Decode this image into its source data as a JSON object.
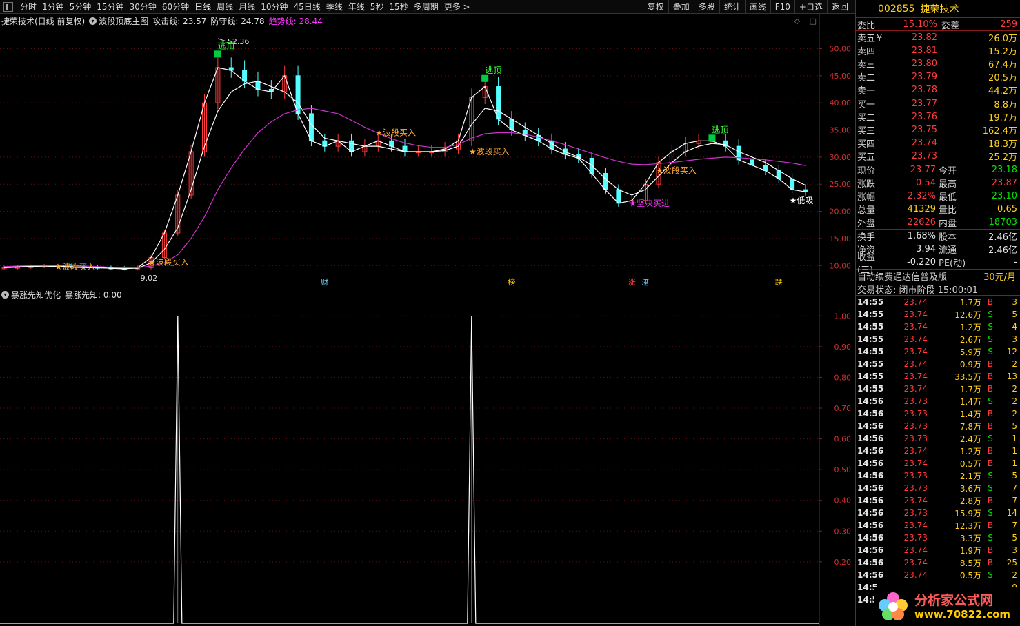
{
  "toolbar": {
    "periods": [
      "分时",
      "1分钟",
      "5分钟",
      "15分钟",
      "30分钟",
      "60分钟",
      "日线",
      "周线",
      "月线",
      "10分钟",
      "45日线",
      "季线",
      "年线",
      "5秒",
      "15秒",
      "多周期",
      "更多 >"
    ],
    "actions": [
      "复权",
      "叠加",
      "多股",
      "统计",
      "画线",
      "F10",
      "+自选",
      "返回"
    ]
  },
  "main_header": {
    "title": "捷荣技术(日线 前复权)",
    "indicator": "波段顶底主图",
    "attack": "攻击线: 23.57",
    "defense": "防守线: 24.78",
    "trend": "趋势线: 28.44"
  },
  "ind_header": {
    "name": "暴涨先知优化",
    "value": "暴涨先知: 0.00"
  },
  "chart_data": [
    {
      "type": "line",
      "title": "捷荣技术(日线 前复权)",
      "xlabel": "",
      "ylabel": "",
      "ylim": [
        8,
        54
      ],
      "yticks": [
        "50.00",
        "45.00",
        "40.00",
        "35.00",
        "30.00",
        "25.00",
        "20.00",
        "15.00",
        "10.00"
      ],
      "max_label": "52.36",
      "min_label": "9.02",
      "series": [
        {
          "name": "攻击线",
          "color": "#ffffff",
          "values": [
            9.6,
            9.7,
            9.8,
            9.9,
            9.9,
            9.8,
            9.7,
            9.6,
            9.5,
            9.4,
            9.6,
            11.5,
            16,
            23,
            31,
            40,
            46.5,
            46,
            44,
            42.5,
            42,
            45,
            38,
            33,
            32,
            33,
            31,
            32,
            33,
            32,
            31,
            31,
            31,
            31.5,
            33,
            41,
            43,
            37,
            35,
            34,
            33,
            31.5,
            30.5,
            29.8,
            27,
            24,
            21.5,
            22,
            25,
            29,
            31,
            32.5,
            33,
            33,
            32,
            29.5,
            28.5,
            27.5,
            26,
            24,
            23.6
          ]
        },
        {
          "name": "防守线",
          "color": "#ffffff",
          "values": [
            9.7,
            9.8,
            9.9,
            9.9,
            9.8,
            9.7,
            9.6,
            9.6,
            9.5,
            9.5,
            9.5,
            10.5,
            13,
            17,
            24,
            32,
            38.5,
            42,
            43.5,
            44,
            43,
            42,
            40,
            36,
            33.5,
            33,
            32.5,
            32,
            32,
            31.5,
            31,
            31,
            31,
            31.2,
            32,
            36,
            39,
            38.5,
            37,
            35.5,
            34,
            32.5,
            31,
            30,
            28.5,
            26,
            24,
            23,
            24,
            26.5,
            29,
            31,
            32,
            32.5,
            32.3,
            31,
            30,
            29,
            27.5,
            26,
            24.8
          ]
        },
        {
          "name": "趋势线",
          "color": "#cc33cc",
          "values": [
            9.8,
            9.9,
            10,
            10,
            10,
            10,
            9.9,
            9.8,
            9.7,
            9.6,
            9.6,
            9.9,
            10.5,
            12,
            15,
            19,
            24,
            28,
            31.5,
            34.5,
            36.5,
            38,
            38.7,
            39,
            38.5,
            38,
            36.8,
            35.5,
            34.4,
            33.4,
            32.6,
            32.1,
            31.8,
            31.8,
            32.3,
            33.5,
            34.3,
            34.5,
            34.5,
            34.2,
            33.7,
            33,
            32.3,
            31.5,
            30.7,
            29.9,
            29.2,
            28.7,
            28.6,
            28.8,
            29,
            29.3,
            29.6,
            29.8,
            30,
            29.9,
            29.7,
            29.5,
            29.2,
            28.9,
            28.44
          ]
        }
      ],
      "annotations": [
        {
          "label": "逃顶",
          "x": 16,
          "value": 49
        },
        {
          "label": "逃顶",
          "x": 36,
          "value": 44.5
        },
        {
          "label": "逃顶",
          "x": 53,
          "value": 33.5
        },
        {
          "label": "波段买入",
          "x": 4,
          "value": 9.8
        },
        {
          "label": "波段买入",
          "x": 11,
          "value": 10.6
        },
        {
          "label": "波段买入",
          "x": 28,
          "value": 34.5
        },
        {
          "label": "波段买入",
          "x": 35,
          "value": 31
        },
        {
          "label": "波段买入",
          "x": 49,
          "value": 27.5
        },
        {
          "label": "坚决买进",
          "x": 47,
          "value": 21.5
        },
        {
          "label": "低吸",
          "x": 59,
          "value": 22
        }
      ],
      "events": [
        {
          "label": "财",
          "x": 24,
          "color": "#66ccff"
        },
        {
          "label": "榜",
          "x": 38,
          "color": "#ffcc00"
        },
        {
          "label": "涨",
          "x": 47,
          "color": "#ff4444"
        },
        {
          "label": "港",
          "x": 48,
          "color": "#66ccff"
        },
        {
          "label": "跌",
          "x": 58,
          "color": "#ffcc00"
        }
      ],
      "grid": true
    },
    {
      "type": "line",
      "title": "暴涨先知优化",
      "xlabel": "",
      "ylabel": "",
      "ylim": [
        0,
        1.05
      ],
      "yticks": [
        "1.00",
        "0.90",
        "0.80",
        "0.70",
        "0.60",
        "0.50",
        "0.40",
        "0.30",
        "0.20"
      ],
      "series": [
        {
          "name": "暴涨先知",
          "color": "#ffffff",
          "spikes": [
            {
              "x": 13,
              "value": 1.0
            },
            {
              "x": 35,
              "value": 1.0
            }
          ]
        }
      ],
      "grid": true
    }
  ],
  "quote": {
    "code": "002855",
    "name": "捷荣技术",
    "weibi_label": "委比",
    "weibi": "15.10%",
    "weicha_label": "委差",
    "weicha": "259",
    "sells": [
      {
        "label": "卖五",
        "mark": "¥",
        "price": "23.82",
        "vol": "26.0万"
      },
      {
        "label": "卖四",
        "mark": "",
        "price": "23.81",
        "vol": "15.2万"
      },
      {
        "label": "卖三",
        "mark": "",
        "price": "23.80",
        "vol": "67.4万"
      },
      {
        "label": "卖二",
        "mark": "",
        "price": "23.79",
        "vol": "20.5万"
      },
      {
        "label": "卖一",
        "mark": "",
        "price": "23.78",
        "vol": "44.2万"
      }
    ],
    "buys": [
      {
        "label": "买一",
        "price": "23.77",
        "vol": "8.8万"
      },
      {
        "label": "买二",
        "price": "23.76",
        "vol": "19.7万"
      },
      {
        "label": "买三",
        "price": "23.75",
        "vol": "162.4万"
      },
      {
        "label": "买四",
        "price": "23.74",
        "vol": "18.3万"
      },
      {
        "label": "买五",
        "price": "23.73",
        "vol": "25.2万"
      }
    ],
    "stats1": [
      {
        "l1": "现价",
        "v1": "23.77",
        "c1": "red",
        "l2": "今开",
        "v2": "23.18",
        "c2": "green"
      },
      {
        "l1": "涨跌",
        "v1": "0.54",
        "c1": "red",
        "l2": "最高",
        "v2": "23.87",
        "c2": "red"
      },
      {
        "l1": "涨幅",
        "v1": "2.32%",
        "c1": "red",
        "l2": "最低",
        "v2": "23.10",
        "c2": "green"
      },
      {
        "l1": "总量",
        "v1": "41329",
        "c1": "yellow",
        "l2": "量比",
        "v2": "0.65",
        "c2": "yellow"
      },
      {
        "l1": "外盘",
        "v1": "22626",
        "c1": "red",
        "l2": "内盘",
        "v2": "18703",
        "c2": "green"
      }
    ],
    "stats2": [
      {
        "l1": "换手",
        "v1": "1.68%",
        "c1": "white",
        "l2": "股本",
        "v2": "2.46亿",
        "c2": "white"
      },
      {
        "l1": "净资",
        "v1": "3.94",
        "c1": "white",
        "l2": "流通",
        "v2": "2.46亿",
        "c2": "white"
      },
      {
        "l1": "收益(三)",
        "v1": "-0.220",
        "c1": "white",
        "l2": "PE(动)",
        "v2": "-",
        "c2": "white"
      }
    ],
    "fee_text": "自动续费通达信普及版",
    "fee_price": "30元/月",
    "status": "交易状态: 闭市阶段 15:00:01",
    "ticks": [
      {
        "t": "14:55",
        "p": "23.74",
        "v": "1.7万",
        "d": "B",
        "n": "3"
      },
      {
        "t": "14:55",
        "p": "23.74",
        "v": "12.6万",
        "d": "S",
        "n": "5"
      },
      {
        "t": "14:55",
        "p": "23.74",
        "v": "1.2万",
        "d": "S",
        "n": "4"
      },
      {
        "t": "14:55",
        "p": "23.74",
        "v": "2.6万",
        "d": "S",
        "n": "3"
      },
      {
        "t": "14:55",
        "p": "23.74",
        "v": "5.9万",
        "d": "S",
        "n": "12"
      },
      {
        "t": "14:55",
        "p": "23.74",
        "v": "0.9万",
        "d": "B",
        "n": "2"
      },
      {
        "t": "14:55",
        "p": "23.74",
        "v": "33.5万",
        "d": "B",
        "n": "13"
      },
      {
        "t": "14:55",
        "p": "23.74",
        "v": "1.7万",
        "d": "B",
        "n": "2"
      },
      {
        "t": "14:56",
        "p": "23.73",
        "v": "1.4万",
        "d": "S",
        "n": "2"
      },
      {
        "t": "14:56",
        "p": "23.73",
        "v": "1.4万",
        "d": "B",
        "n": "2"
      },
      {
        "t": "14:56",
        "p": "23.73",
        "v": "7.8万",
        "d": "B",
        "n": "5"
      },
      {
        "t": "14:56",
        "p": "23.73",
        "v": "2.4万",
        "d": "S",
        "n": "1"
      },
      {
        "t": "14:56",
        "p": "23.74",
        "v": "1.2万",
        "d": "B",
        "n": "1"
      },
      {
        "t": "14:56",
        "p": "23.74",
        "v": "0.5万",
        "d": "B",
        "n": "1"
      },
      {
        "t": "14:56",
        "p": "23.73",
        "v": "2.1万",
        "d": "S",
        "n": "5"
      },
      {
        "t": "14:56",
        "p": "23.73",
        "v": "3.6万",
        "d": "S",
        "n": "7"
      },
      {
        "t": "14:56",
        "p": "23.74",
        "v": "2.8万",
        "d": "B",
        "n": "7"
      },
      {
        "t": "14:56",
        "p": "23.73",
        "v": "15.9万",
        "d": "S",
        "n": "14"
      },
      {
        "t": "14:56",
        "p": "23.74",
        "v": "12.3万",
        "d": "B",
        "n": "7"
      },
      {
        "t": "14:56",
        "p": "23.73",
        "v": "3.3万",
        "d": "S",
        "n": "5"
      },
      {
        "t": "14:56",
        "p": "23.74",
        "v": "1.9万",
        "d": "B",
        "n": "3"
      },
      {
        "t": "14:56",
        "p": "23.74",
        "v": "8.5万",
        "d": "B",
        "n": "25"
      },
      {
        "t": "14:56",
        "p": "23.74",
        "v": "0.5万",
        "d": "S",
        "n": "2"
      },
      {
        "t": "14:5",
        "p": "",
        "v": "",
        "d": "",
        "n": "9"
      },
      {
        "t": "14:5",
        "p": "",
        "v": "",
        "d": "",
        "n": "1"
      }
    ]
  },
  "watermark": {
    "title": "分析家公式网",
    "url": "www.70822.com"
  },
  "colors": {
    "up": "#ff3b3b",
    "down": "#54ffff",
    "grid": "#8a1a1a",
    "attack": "#ffffff",
    "trend": "#cc33cc",
    "annotation_buy": "#ffaa33",
    "annotation_top": "#33ff33",
    "annotation_firm": "#ff33ff"
  }
}
